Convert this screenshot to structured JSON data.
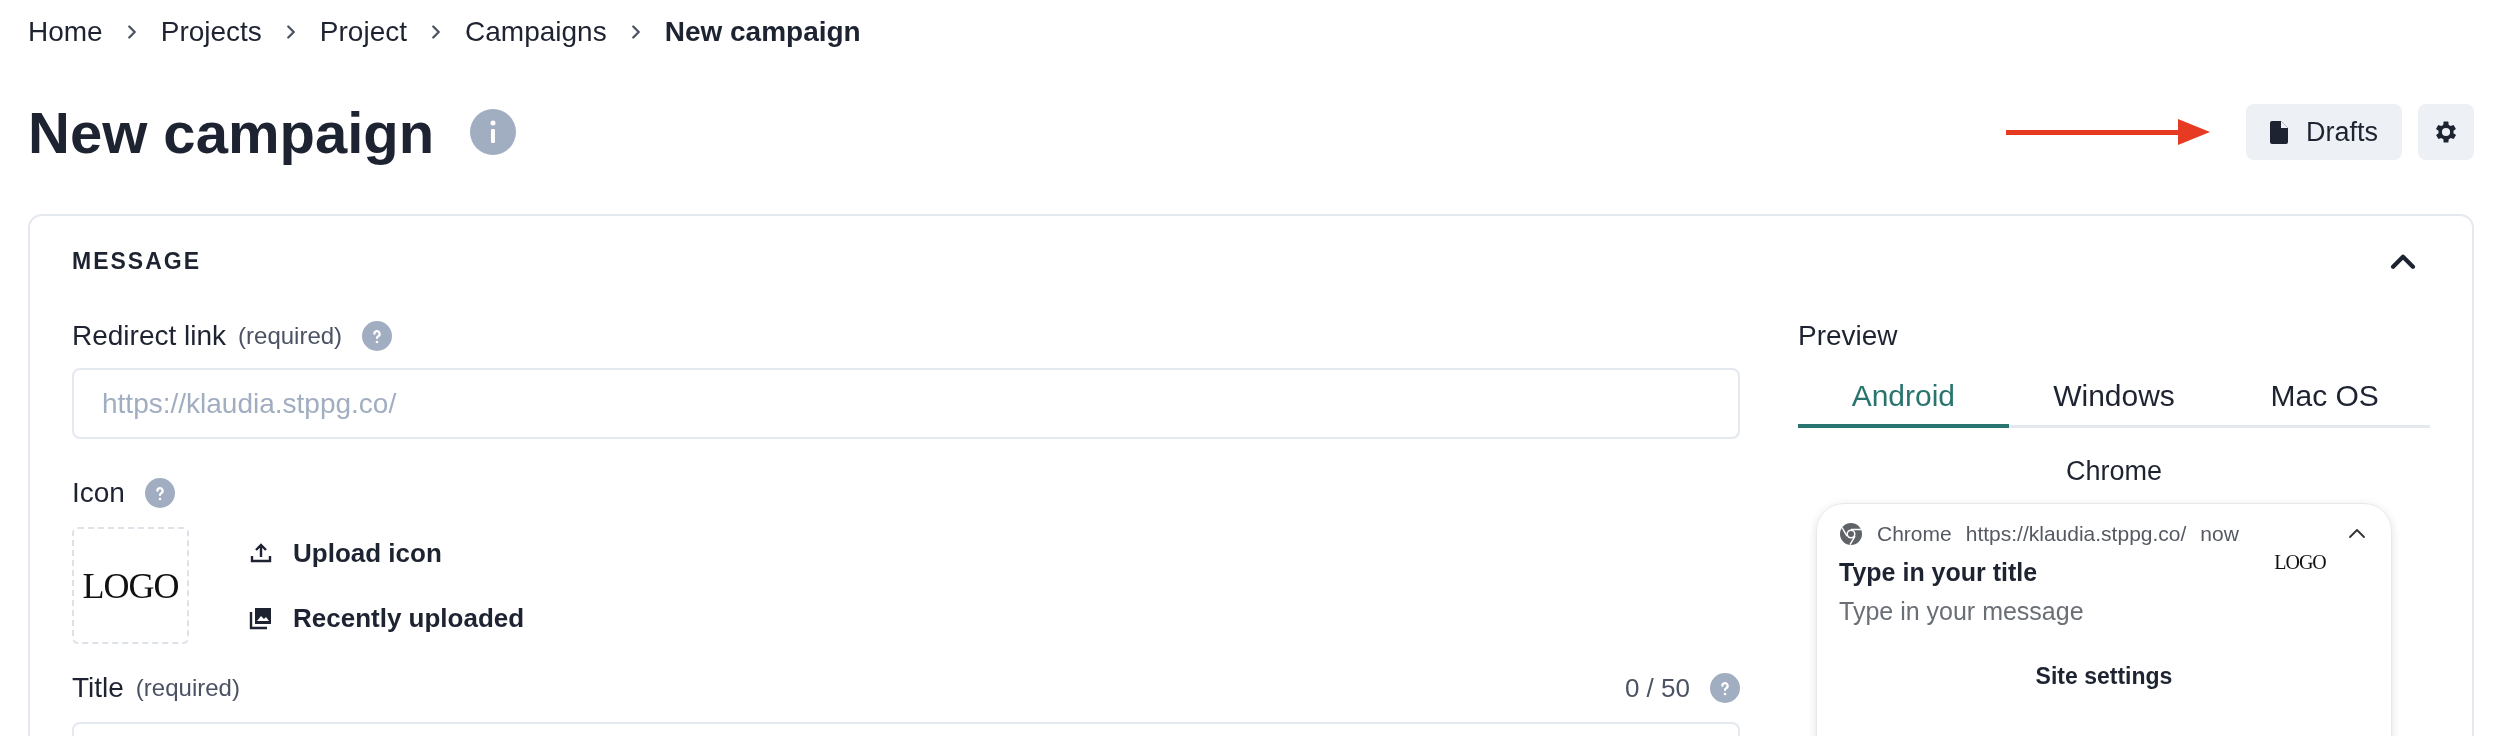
{
  "breadcrumb": [
    {
      "label": "Home",
      "current": false
    },
    {
      "label": "Projects",
      "current": false
    },
    {
      "label": "Project",
      "current": false
    },
    {
      "label": "Campaigns",
      "current": false
    },
    {
      "label": "New campaign",
      "current": true
    }
  ],
  "page_title": "New campaign",
  "header_buttons": {
    "drafts": "Drafts"
  },
  "section": {
    "title": "MESSAGE",
    "expanded": true
  },
  "form": {
    "redirect_link": {
      "label": "Redirect link",
      "note": "(required)",
      "placeholder": "https://klaudia.stppg.co/"
    },
    "icon": {
      "label": "Icon",
      "logo": "LOGO",
      "actions": [
        {
          "kind": "upload",
          "label": "Upload icon"
        },
        {
          "kind": "recent",
          "label": "Recently uploaded"
        }
      ]
    },
    "title": {
      "label": "Title",
      "note": "(required)",
      "counter": "0 / 50"
    }
  },
  "preview": {
    "label": "Preview",
    "tabs": [
      {
        "label": "Android",
        "selected": true
      },
      {
        "label": "Windows",
        "selected": false
      },
      {
        "label": "Mac OS",
        "selected": false
      }
    ],
    "browser": "Chrome",
    "notification": {
      "app": "Chrome",
      "url": "https://klaudia.stppg.co/",
      "time": "now",
      "logo": "LOGO",
      "title": "Type in your title",
      "message": "Type in your message",
      "action": "Site settings"
    }
  }
}
